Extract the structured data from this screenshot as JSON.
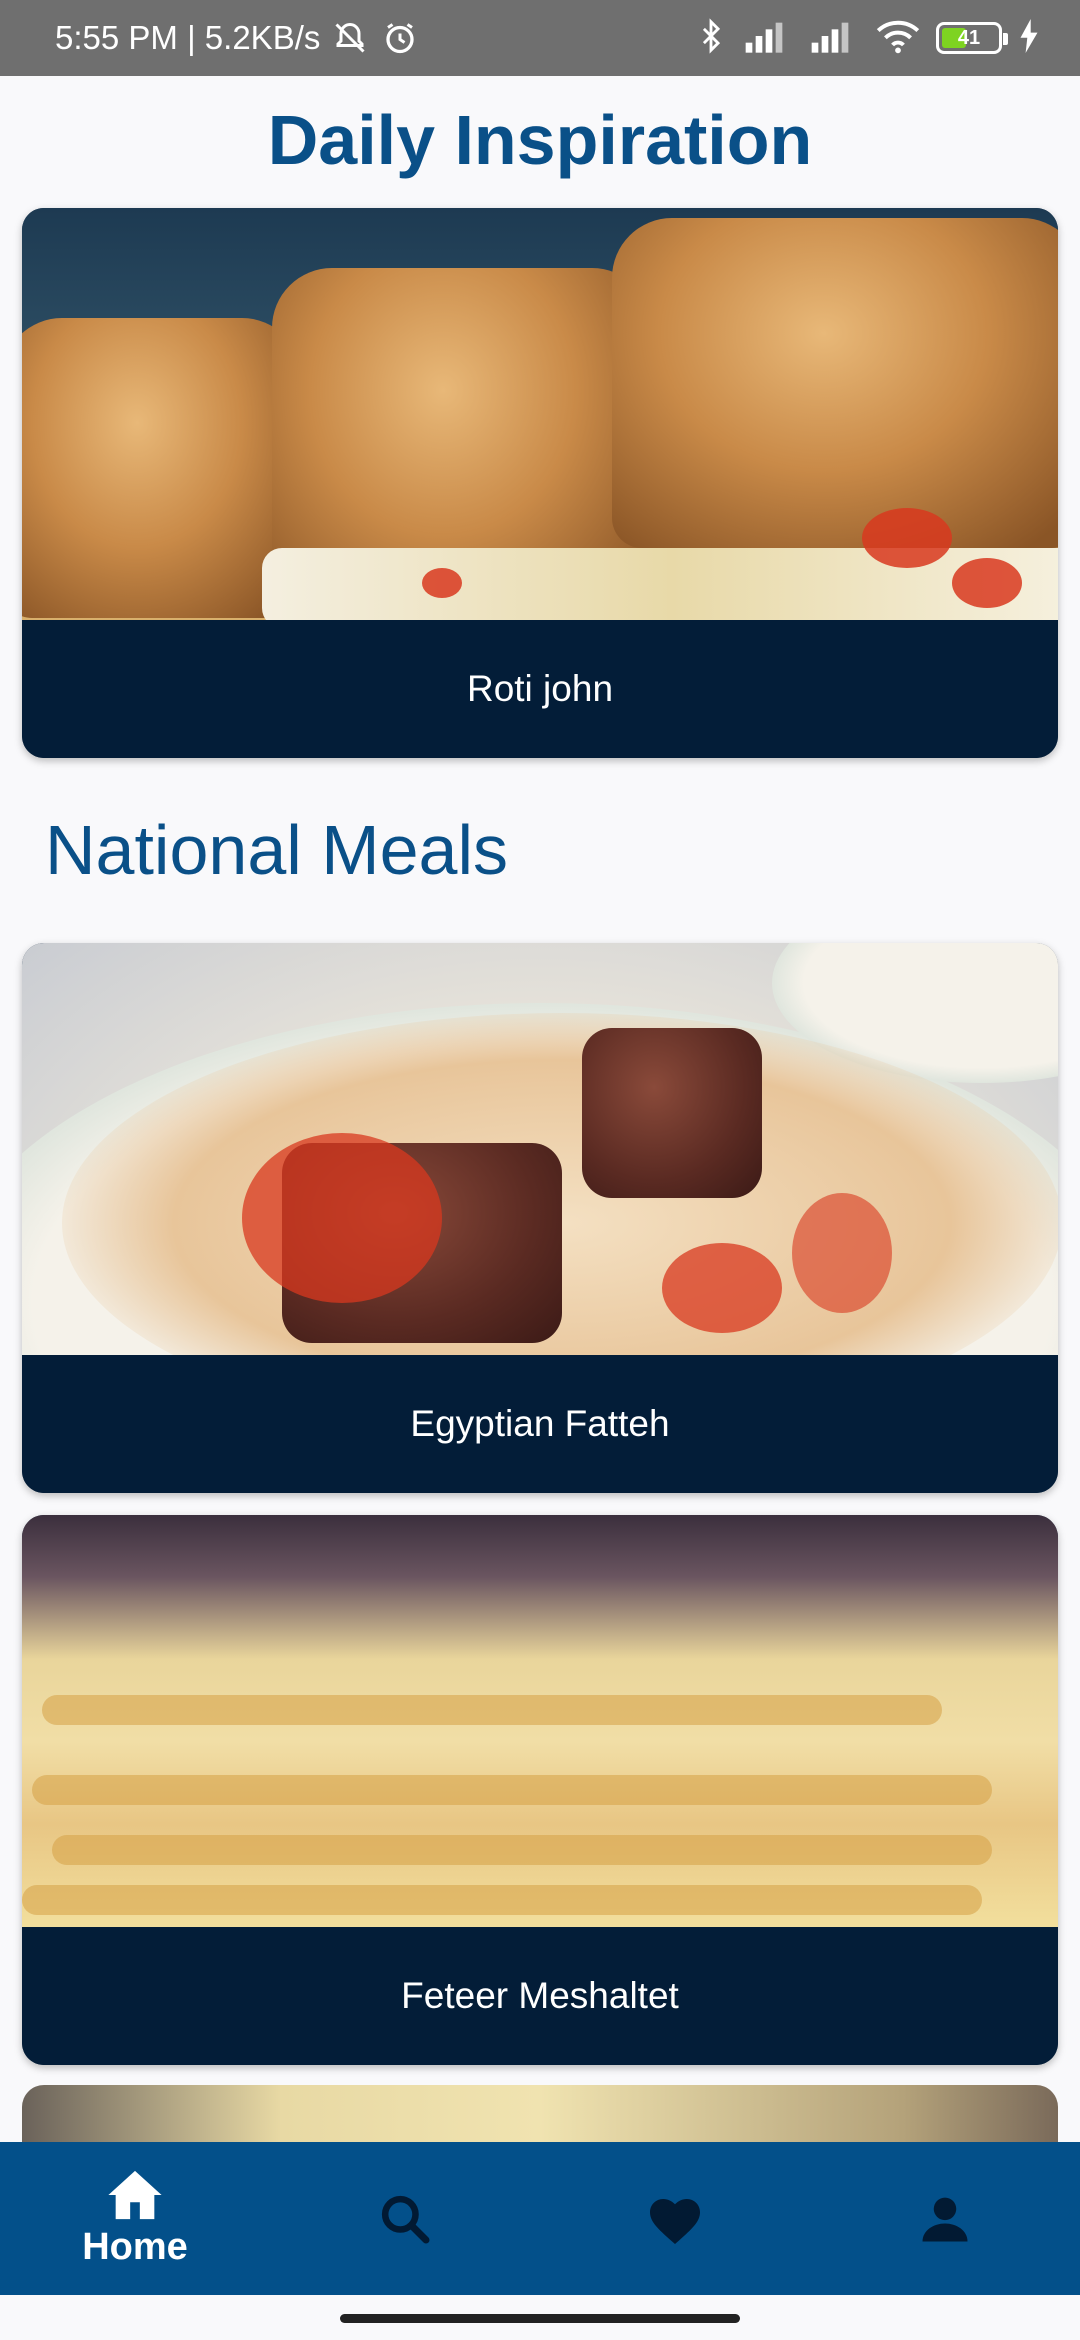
{
  "status_bar": {
    "time_speed": "5:55 PM | 5.2KB/s",
    "battery": "41"
  },
  "header": {
    "title": "Daily Inspiration"
  },
  "daily_card": {
    "caption": "Roti john"
  },
  "section": {
    "title": "National Meals"
  },
  "meals": [
    {
      "caption": "Egyptian Fatteh"
    },
    {
      "caption": "Feteer Meshaltet"
    }
  ],
  "bottom_nav": {
    "items": [
      {
        "icon": "home-icon",
        "label": "Home",
        "active": true
      },
      {
        "icon": "search-icon",
        "label": "",
        "active": false
      },
      {
        "icon": "heart-icon",
        "label": "",
        "active": false
      },
      {
        "icon": "profile-icon",
        "label": "",
        "active": false
      }
    ]
  },
  "colors": {
    "accent": "#0a5088",
    "nav_bg": "#03508a",
    "card_caption_bg": "#031d38"
  }
}
